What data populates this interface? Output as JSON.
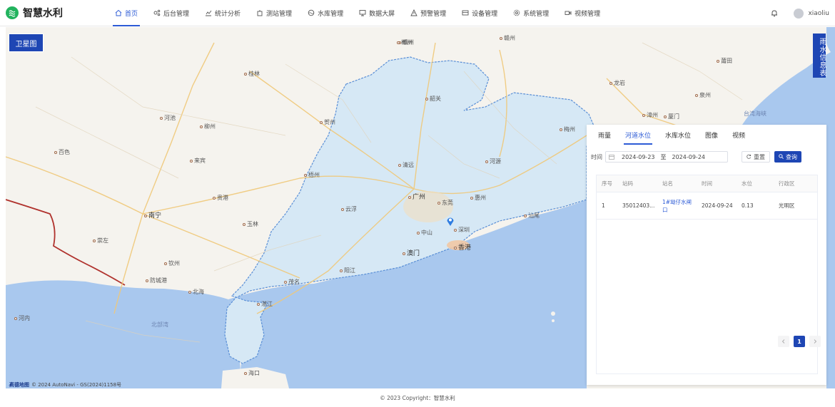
{
  "app": {
    "title": "智慧水利"
  },
  "nav": [
    {
      "label": "首页",
      "icon": "home-icon",
      "active": true
    },
    {
      "label": "后台管理",
      "icon": "nodes-icon"
    },
    {
      "label": "统计分析",
      "icon": "chart-icon"
    },
    {
      "label": "测站管理",
      "icon": "station-icon"
    },
    {
      "label": "水库管理",
      "icon": "reservoir-icon"
    },
    {
      "label": "数据大屏",
      "icon": "monitor-icon"
    },
    {
      "label": "预警管理",
      "icon": "warning-icon"
    },
    {
      "label": "设备管理",
      "icon": "device-icon"
    },
    {
      "label": "系统管理",
      "icon": "gear-icon"
    },
    {
      "label": "视频管理",
      "icon": "video-icon"
    }
  ],
  "user": {
    "name": "xiaoliu"
  },
  "map": {
    "satellite_label": "卫星图",
    "rain_info_label": "雨水信息表",
    "attribution_brand": "高德地图",
    "attribution_text": "© 2024 AutoNavi - GS(2024)1158号",
    "cities": [
      {
        "name": "赣州"
      },
      {
        "name": "郴州"
      },
      {
        "name": "韶关"
      },
      {
        "name": "梅州"
      },
      {
        "name": "龙岩"
      },
      {
        "name": "泉州"
      },
      {
        "name": "厦门"
      },
      {
        "name": "漳州"
      },
      {
        "name": "莆田"
      },
      {
        "name": "桂林"
      },
      {
        "name": "河池"
      },
      {
        "name": "柳州"
      },
      {
        "name": "贺州"
      },
      {
        "name": "百色"
      },
      {
        "name": "来宾"
      },
      {
        "name": "梧州"
      },
      {
        "name": "清远"
      },
      {
        "name": "河源"
      },
      {
        "name": "广州"
      },
      {
        "name": "东莞"
      },
      {
        "name": "惠州"
      },
      {
        "name": "汕尾"
      },
      {
        "name": "云浮"
      },
      {
        "name": "贵港"
      },
      {
        "name": "南宁"
      },
      {
        "name": "玉林"
      },
      {
        "name": "中山"
      },
      {
        "name": "深圳"
      },
      {
        "name": "香港"
      },
      {
        "name": "澳门"
      },
      {
        "name": "崇左"
      },
      {
        "name": "钦州"
      },
      {
        "name": "防城港"
      },
      {
        "name": "北海"
      },
      {
        "name": "茂名"
      },
      {
        "name": "阳江"
      },
      {
        "name": "湛江"
      },
      {
        "name": "海口"
      },
      {
        "name": "河内"
      }
    ],
    "seas": [
      {
        "name": "北部湾"
      },
      {
        "name": "台湾海峡"
      }
    ]
  },
  "panel": {
    "tabs": [
      {
        "label": "雨量"
      },
      {
        "label": "河道水位",
        "active": true
      },
      {
        "label": "水库水位"
      },
      {
        "label": "图像"
      },
      {
        "label": "视频"
      }
    ],
    "filter": {
      "time_label": "时间",
      "start_date": "2024-09-23",
      "separator": "至",
      "end_date": "2024-09-24",
      "reset_label": "重置",
      "query_label": "查询"
    },
    "table": {
      "columns": [
        "序号",
        "站码",
        "站名",
        "时间",
        "水位",
        "行政区"
      ],
      "rows": [
        {
          "index": "1",
          "code": "35012403...",
          "name": "1#坳仔水闸口",
          "time": "2024-09-24",
          "level": "0.13",
          "district": "光明区"
        }
      ]
    },
    "pagination": {
      "current": "1"
    }
  },
  "footer": {
    "text": "© 2023 Copyright：智慧水利"
  },
  "colors": {
    "accent": "#2d5bd6",
    "primary_button": "#1e46b4",
    "brand_green": "#22b35e",
    "province_fill": "#d6e8f5",
    "sea": "#a9c8ee"
  }
}
